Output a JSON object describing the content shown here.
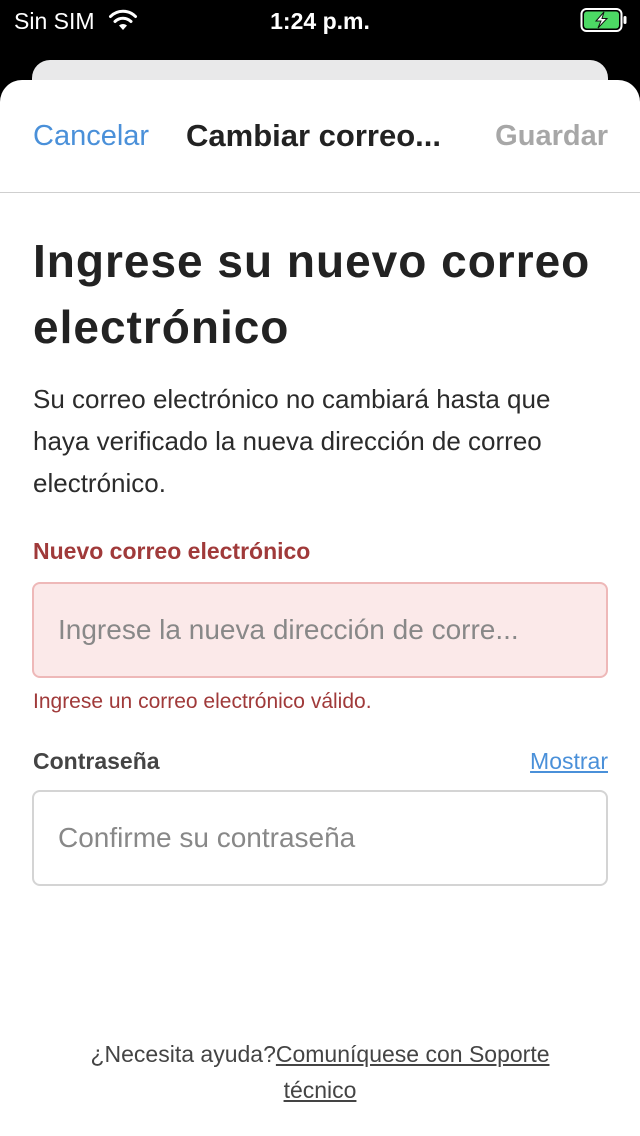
{
  "status_bar": {
    "carrier": "Sin SIM",
    "time": "1:24 p.m.",
    "wifi_icon": "wifi-icon",
    "battery_icon": "battery-charging-icon"
  },
  "nav": {
    "cancel": "Cancelar",
    "title": "Cambiar correo...",
    "save": "Guardar"
  },
  "main": {
    "heading": "Ingrese su nuevo correo electrónico",
    "description": "Su correo electrónico no cambiará hasta que haya verificado la nueva dirección de correo electrónico."
  },
  "email_field": {
    "label": "Nuevo correo electrónico",
    "value": "",
    "placeholder": "Ingrese la nueva dirección de corre...",
    "error": "Ingrese un correo electrónico válido."
  },
  "password_field": {
    "label": "Contraseña",
    "show_label": "Mostrar",
    "value": "",
    "placeholder": "Confirme su contraseña"
  },
  "help": {
    "prefix": "¿Necesita ayuda?",
    "link": "Comuníquese con Soporte técnico"
  },
  "colors": {
    "accent": "#4a90d9",
    "error": "#a03a3a",
    "error_bg": "#fbe9e9",
    "disabled": "#a7a7a7"
  }
}
